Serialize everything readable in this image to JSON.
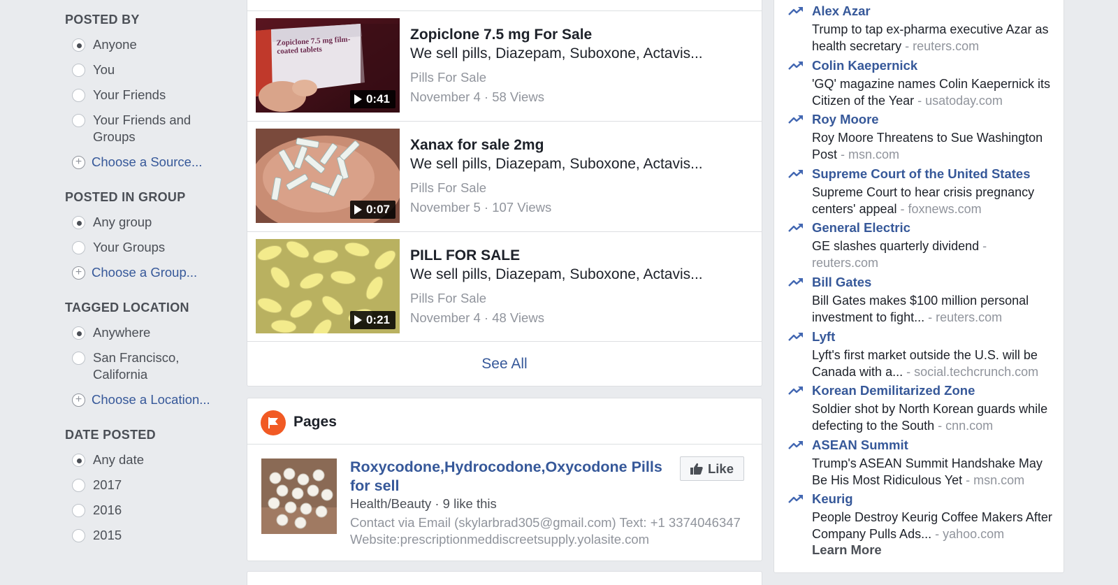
{
  "filters": {
    "posted_by": {
      "heading": "POSTED BY",
      "options": [
        {
          "label": "Anyone",
          "selected": true
        },
        {
          "label": "You",
          "selected": false
        },
        {
          "label": "Your Friends",
          "selected": false
        },
        {
          "label": "Your Friends and Groups",
          "selected": false
        }
      ],
      "choose": "Choose a Source..."
    },
    "posted_in_group": {
      "heading": "POSTED IN GROUP",
      "options": [
        {
          "label": "Any group",
          "selected": true
        },
        {
          "label": "Your Groups",
          "selected": false
        }
      ],
      "choose": "Choose a Group..."
    },
    "tagged_location": {
      "heading": "TAGGED LOCATION",
      "options": [
        {
          "label": "Anywhere",
          "selected": true
        },
        {
          "label": "San Francisco, California",
          "selected": false
        }
      ],
      "choose": "Choose a Location..."
    },
    "date_posted": {
      "heading": "DATE POSTED",
      "options": [
        {
          "label": "Any date",
          "selected": true
        },
        {
          "label": "2017",
          "selected": false
        },
        {
          "label": "2016",
          "selected": false
        },
        {
          "label": "2015",
          "selected": false
        }
      ]
    }
  },
  "videos": [
    {
      "title": "Zopiclone 7.5 mg For Sale",
      "description": "We sell pills, Diazepam, Suboxone, Actavis...",
      "source": "Pills For Sale",
      "meta": "November 4 · 58 Views",
      "duration": "0:41",
      "thumb_text": "Zopiclone 7.5 mg film-coated tablets"
    },
    {
      "title": "Xanax for sale 2mg",
      "description": "We sell pills, Diazepam, Suboxone, Actavis...",
      "source": "Pills For Sale",
      "meta": "November 5 · 107 Views",
      "duration": "0:07"
    },
    {
      "title": "PILL FOR SALE",
      "description": "We sell pills, Diazepam, Suboxone, Actavis...",
      "source": "Pills For Sale",
      "meta": "November 4 · 48 Views",
      "duration": "0:21"
    }
  ],
  "see_all": "See All",
  "pages": {
    "heading": "Pages",
    "result": {
      "name": "Roxycodone,Hydrocodone,Oxycodone Pills for sell",
      "category": "Health/Beauty · 9 like this",
      "contact": "Contact via Email (skylarbrad305@gmail.com) Text: +1 3374046347",
      "website": "Website:prescriptionmeddiscreetsupply.yolasite.com",
      "like_label": "Like"
    }
  },
  "trending": {
    "items": [
      {
        "topic": "Alex Azar",
        "headline": "Trump to tap ex-pharma executive Azar as health secretary",
        "source": "reuters.com"
      },
      {
        "topic": "Colin Kaepernick",
        "headline": "'GQ' magazine names Colin Kaepernick its Citizen of the Year",
        "source": "usatoday.com"
      },
      {
        "topic": "Roy Moore",
        "headline": "Roy Moore Threatens to Sue Washington Post",
        "source": "msn.com"
      },
      {
        "topic": "Supreme Court of the United States",
        "headline": "Supreme Court to hear crisis pregnancy centers' appeal",
        "source": "foxnews.com"
      },
      {
        "topic": "General Electric",
        "headline": "GE slashes quarterly dividend",
        "source": "reuters.com"
      },
      {
        "topic": "Bill Gates",
        "headline": "Bill Gates makes $100 million personal investment to fight...",
        "source": "reuters.com"
      },
      {
        "topic": "Lyft",
        "headline": "Lyft's first market outside the U.S. will be Canada with a...",
        "source": "social.techcrunch.com"
      },
      {
        "topic": "Korean Demilitarized Zone",
        "headline": "Soldier shot by North Korean guards while defecting to the South",
        "source": "cnn.com"
      },
      {
        "topic": "ASEAN Summit",
        "headline": "Trump's ASEAN Summit Handshake May Be His Most Ridiculous Yet",
        "source": "msn.com"
      },
      {
        "topic": "Keurig",
        "headline": "People Destroy Keurig Coffee Makers After Company Pulls Ads...",
        "source": "yahoo.com"
      }
    ],
    "learn_more": "Learn More",
    "source_separator": " - "
  },
  "colors": {
    "link": "#365899",
    "background": "#e9ebee",
    "pages_badge": "#f15a24"
  }
}
